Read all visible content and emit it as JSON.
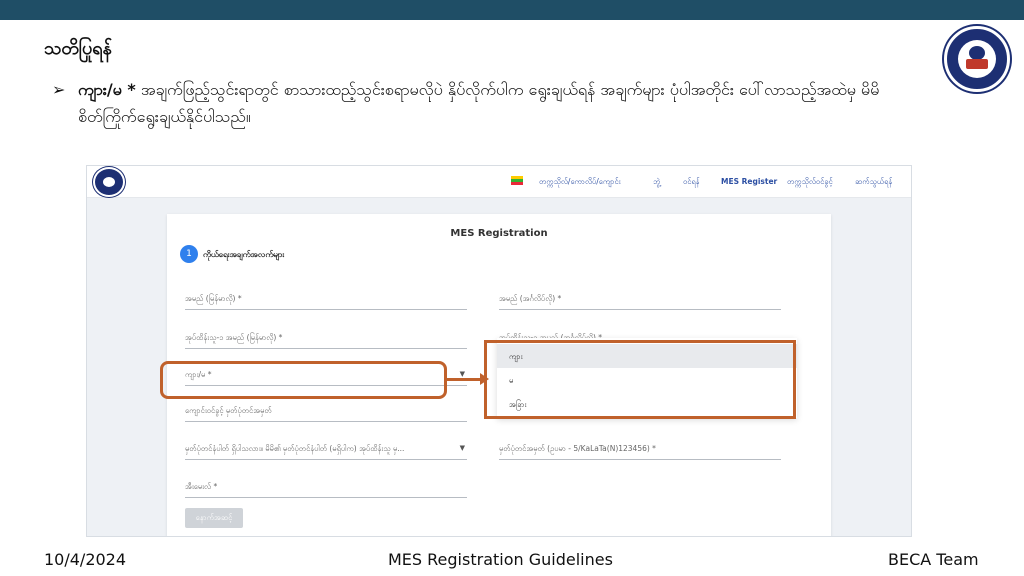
{
  "colors": {
    "topbar": "#1f4e66",
    "accent": "#c0612b",
    "link": "#2c4fa3",
    "step": "#2f80ed"
  },
  "slide": {
    "title": "သတိပြုရန်",
    "bullet_key": "ကျား/မ *",
    "bullet_text": " အချက်ဖြည့်သွင်းရာတွင် စာသားထည့်သွင်းစရာမလိုပဲ နှိပ်လိုက်ပါက ရွေးချယ်ရန် အချက်များ ပုံပါအတိုင်း ပေါ်လာသည့်အထဲမှ မိမိစိတ်ကြိုက်ရွေးချယ်နိုင်ပါသည်။"
  },
  "nav": {
    "items": [
      "တက္ကသိုလ်/ကောလိပ်/ကျောင်း",
      "ဘွဲ့",
      "ဝင်ရန်",
      "MES Register",
      "တက္ကသိုလ်ဝင်ခွင့်",
      "ဆက်သွယ်ရန်"
    ]
  },
  "form": {
    "title": "MES Registration",
    "step_number": "1",
    "step_label": "ကိုယ်ရေးအချက်အလက်များ",
    "fields": {
      "name_mm": "အမည် (မြန်မာလို) *",
      "name_en": "အမည် (အင်္ဂလိပ်လို) *",
      "guardian_mm": "အုပ်ထိန်းသူ-၁ အမည် (မြန်မာလို) *",
      "guardian_en": "အုပ်ထိန်းသူ-၁ အမည် (အင်္ဂလိပ်လို) *",
      "gender": "ကျား/မ *",
      "school_id": "ကျောင်းဝင်ခွင့် မှတ်ပုံတင်အမှတ်",
      "nrc_holder": "မှတ်ပုံတင်နံပါတ် ရှိပါသလား။ မိမိ၏ မှတ်ပုံတင်နံပါတ် (မရှိပါက) အုပ်ထိန်းသူ မှ...",
      "nrc_number": "မှတ်ပုံတင်အမှတ် (ဥပမာ - 5/KaLaTa(N)123456) *",
      "email": "အီးမေးလ် *"
    },
    "next_button": "နောက်အဆင့်"
  },
  "dropdown": {
    "options": [
      "ကျား",
      "မ",
      "အခြား"
    ],
    "selected": "ကျား"
  },
  "footer": {
    "date": "10/4/2024",
    "center": "MES Registration Guidelines",
    "right": "BECA Team"
  }
}
